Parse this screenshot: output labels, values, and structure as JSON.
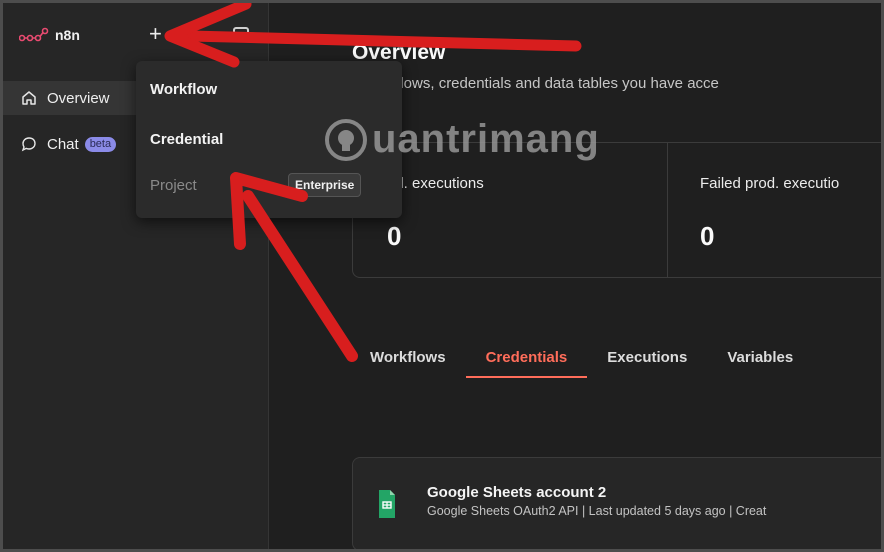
{
  "app": {
    "name": "n8n"
  },
  "sidebar": {
    "items": [
      {
        "label": "Overview",
        "icon": "home-icon"
      },
      {
        "label": "Chat",
        "icon": "chat-icon",
        "badge": "beta"
      }
    ]
  },
  "dropdown": {
    "items": [
      {
        "label": "Workflow"
      },
      {
        "label": "Credential"
      },
      {
        "label": "Project",
        "badge": "Enterprise",
        "disabled": true
      }
    ]
  },
  "main": {
    "title": "Overview",
    "subtitle": "e workflows, credentials and data tables you have acce",
    "stats": [
      {
        "label": "od. executions",
        "value": "0"
      },
      {
        "label": "Failed prod. executio",
        "value": "0"
      }
    ],
    "tabs": [
      {
        "label": "Workflows",
        "active": false
      },
      {
        "label": "Credentials",
        "active": true
      },
      {
        "label": "Executions",
        "active": false
      },
      {
        "label": "Variables",
        "active": false
      }
    ],
    "card": {
      "title": "Google Sheets account 2",
      "meta": "Google Sheets OAuth2 API | Last updated 5 days ago | Creat"
    }
  },
  "watermark": {
    "text": "uantrimang"
  },
  "colors": {
    "accent": "#ff6d5a",
    "brand": "#ea4b71",
    "beta_badge": "#8b8be8",
    "annotation_arrow": "#d81e1e",
    "sheets_green": "#23a566"
  }
}
